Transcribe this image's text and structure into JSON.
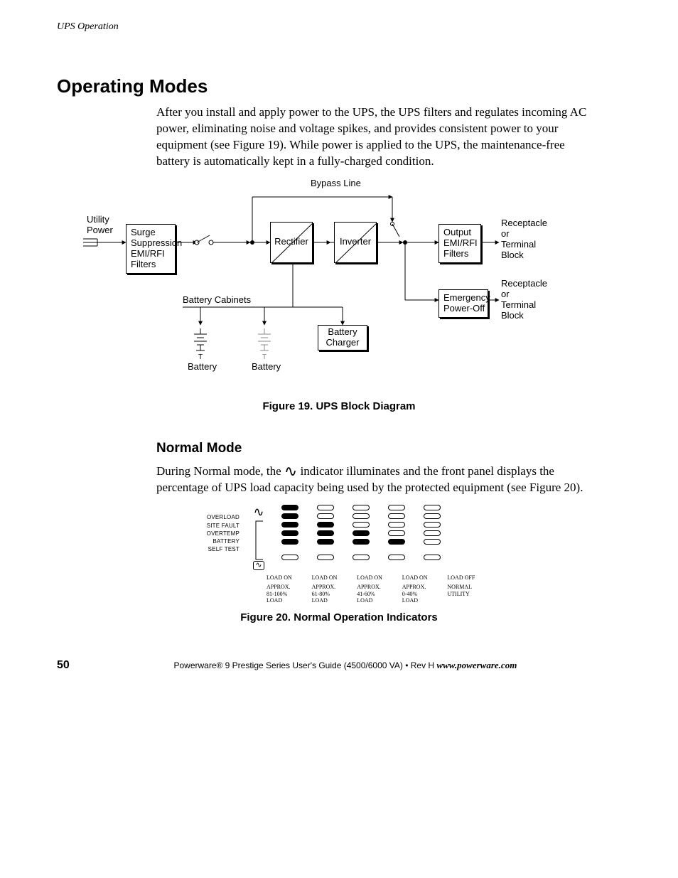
{
  "header_running": "UPS Operation",
  "h1": "Operating Modes",
  "intro_para": "After you install and apply power to the UPS, the UPS filters and regulates incoming AC power, eliminating noise and voltage spikes, and provides consistent power to your equipment (see Figure 19). While power is applied to the UPS, the maintenance-free battery is automatically kept in a fully-charged condition.",
  "fig19": {
    "caption": "Figure 19. UPS Block Diagram",
    "bypass_line": "Bypass Line",
    "utility_power": "Utility\nPower",
    "surge": "Surge\nSuppression\nEMI/RFI\nFilters",
    "rectifier": "Rectifier",
    "inverter": "Inverter",
    "output": "Output\nEMI/RFI\nFilters",
    "recept1": "Receptacle\nor\nTerminal\nBlock",
    "epo": "Emergency\nPower-Off",
    "recept2": "Receptacle\nor\nTerminal\nBlock",
    "battery_cabinets": "Battery Cabinets",
    "battery1": "Battery",
    "battery2": "Battery",
    "charger": "Battery\nCharger"
  },
  "h2": "Normal Mode",
  "normal_para_pre": "During Normal mode, the ",
  "normal_para_post": " indicator illuminates and the front panel displays the percentage of UPS load capacity being used by the protected equipment (see Figure 20).",
  "fig20": {
    "caption": "Figure 20. Normal Operation Indicators",
    "side_labels": [
      "OVERLOAD",
      "SITE FAULT",
      "OVERTEMP",
      "BATTERY",
      "SELF TEST"
    ],
    "columns": [
      {
        "on": [
          1,
          1,
          1,
          1,
          1
        ],
        "load_line": "LOAD ON",
        "sub": "APPROX.\n81-100%\nLOAD"
      },
      {
        "on": [
          0,
          0,
          1,
          1,
          1
        ],
        "load_line": "LOAD ON",
        "sub": "APPROX.\n61-80%\nLOAD"
      },
      {
        "on": [
          0,
          0,
          0,
          1,
          1
        ],
        "load_line": "LOAD ON",
        "sub": "APPROX.\n41-60%\nLOAD"
      },
      {
        "on": [
          0,
          0,
          0,
          0,
          1
        ],
        "load_line": "LOAD ON",
        "sub": "APPROX.\n0-40%\nLOAD"
      },
      {
        "on": [
          0,
          0,
          0,
          0,
          0
        ],
        "load_line": "LOAD OFF",
        "sub": "NORMAL\nUTILITY"
      }
    ]
  },
  "footer": {
    "page": "50",
    "center_plain": "Powerware® 9 Prestige Series User's Guide (4500/6000 VA)  •  Rev H ",
    "center_url": "www.powerware.com"
  }
}
